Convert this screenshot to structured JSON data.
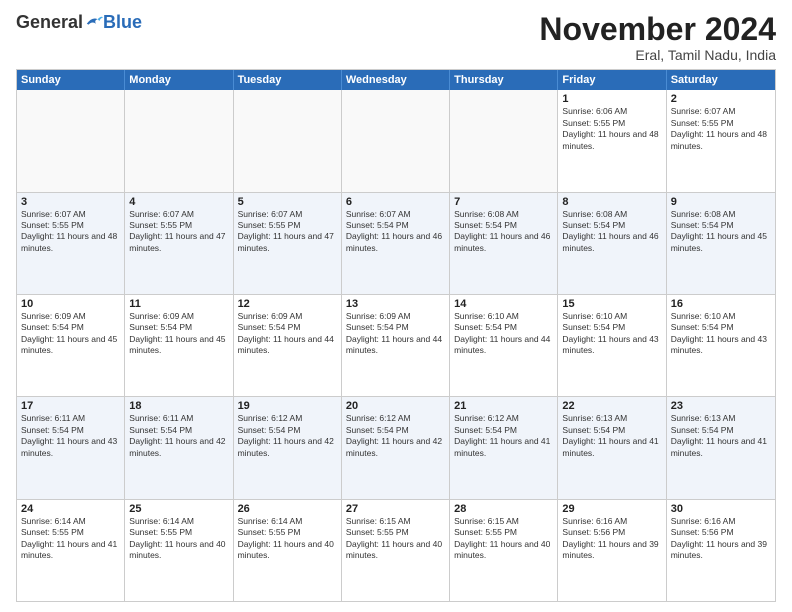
{
  "logo": {
    "general": "General",
    "blue": "Blue"
  },
  "title": "November 2024",
  "location": "Eral, Tamil Nadu, India",
  "header_days": [
    "Sunday",
    "Monday",
    "Tuesday",
    "Wednesday",
    "Thursday",
    "Friday",
    "Saturday"
  ],
  "weeks": [
    [
      {
        "day": "",
        "text": "",
        "empty": true
      },
      {
        "day": "",
        "text": "",
        "empty": true
      },
      {
        "day": "",
        "text": "",
        "empty": true
      },
      {
        "day": "",
        "text": "",
        "empty": true
      },
      {
        "day": "",
        "text": "",
        "empty": true
      },
      {
        "day": "1",
        "text": "Sunrise: 6:06 AM\nSunset: 5:55 PM\nDaylight: 11 hours and 48 minutes.",
        "empty": false
      },
      {
        "day": "2",
        "text": "Sunrise: 6:07 AM\nSunset: 5:55 PM\nDaylight: 11 hours and 48 minutes.",
        "empty": false
      }
    ],
    [
      {
        "day": "3",
        "text": "Sunrise: 6:07 AM\nSunset: 5:55 PM\nDaylight: 11 hours and 48 minutes.",
        "empty": false
      },
      {
        "day": "4",
        "text": "Sunrise: 6:07 AM\nSunset: 5:55 PM\nDaylight: 11 hours and 47 minutes.",
        "empty": false
      },
      {
        "day": "5",
        "text": "Sunrise: 6:07 AM\nSunset: 5:55 PM\nDaylight: 11 hours and 47 minutes.",
        "empty": false
      },
      {
        "day": "6",
        "text": "Sunrise: 6:07 AM\nSunset: 5:54 PM\nDaylight: 11 hours and 46 minutes.",
        "empty": false
      },
      {
        "day": "7",
        "text": "Sunrise: 6:08 AM\nSunset: 5:54 PM\nDaylight: 11 hours and 46 minutes.",
        "empty": false
      },
      {
        "day": "8",
        "text": "Sunrise: 6:08 AM\nSunset: 5:54 PM\nDaylight: 11 hours and 46 minutes.",
        "empty": false
      },
      {
        "day": "9",
        "text": "Sunrise: 6:08 AM\nSunset: 5:54 PM\nDaylight: 11 hours and 45 minutes.",
        "empty": false
      }
    ],
    [
      {
        "day": "10",
        "text": "Sunrise: 6:09 AM\nSunset: 5:54 PM\nDaylight: 11 hours and 45 minutes.",
        "empty": false
      },
      {
        "day": "11",
        "text": "Sunrise: 6:09 AM\nSunset: 5:54 PM\nDaylight: 11 hours and 45 minutes.",
        "empty": false
      },
      {
        "day": "12",
        "text": "Sunrise: 6:09 AM\nSunset: 5:54 PM\nDaylight: 11 hours and 44 minutes.",
        "empty": false
      },
      {
        "day": "13",
        "text": "Sunrise: 6:09 AM\nSunset: 5:54 PM\nDaylight: 11 hours and 44 minutes.",
        "empty": false
      },
      {
        "day": "14",
        "text": "Sunrise: 6:10 AM\nSunset: 5:54 PM\nDaylight: 11 hours and 44 minutes.",
        "empty": false
      },
      {
        "day": "15",
        "text": "Sunrise: 6:10 AM\nSunset: 5:54 PM\nDaylight: 11 hours and 43 minutes.",
        "empty": false
      },
      {
        "day": "16",
        "text": "Sunrise: 6:10 AM\nSunset: 5:54 PM\nDaylight: 11 hours and 43 minutes.",
        "empty": false
      }
    ],
    [
      {
        "day": "17",
        "text": "Sunrise: 6:11 AM\nSunset: 5:54 PM\nDaylight: 11 hours and 43 minutes.",
        "empty": false
      },
      {
        "day": "18",
        "text": "Sunrise: 6:11 AM\nSunset: 5:54 PM\nDaylight: 11 hours and 42 minutes.",
        "empty": false
      },
      {
        "day": "19",
        "text": "Sunrise: 6:12 AM\nSunset: 5:54 PM\nDaylight: 11 hours and 42 minutes.",
        "empty": false
      },
      {
        "day": "20",
        "text": "Sunrise: 6:12 AM\nSunset: 5:54 PM\nDaylight: 11 hours and 42 minutes.",
        "empty": false
      },
      {
        "day": "21",
        "text": "Sunrise: 6:12 AM\nSunset: 5:54 PM\nDaylight: 11 hours and 41 minutes.",
        "empty": false
      },
      {
        "day": "22",
        "text": "Sunrise: 6:13 AM\nSunset: 5:54 PM\nDaylight: 11 hours and 41 minutes.",
        "empty": false
      },
      {
        "day": "23",
        "text": "Sunrise: 6:13 AM\nSunset: 5:54 PM\nDaylight: 11 hours and 41 minutes.",
        "empty": false
      }
    ],
    [
      {
        "day": "24",
        "text": "Sunrise: 6:14 AM\nSunset: 5:55 PM\nDaylight: 11 hours and 41 minutes.",
        "empty": false
      },
      {
        "day": "25",
        "text": "Sunrise: 6:14 AM\nSunset: 5:55 PM\nDaylight: 11 hours and 40 minutes.",
        "empty": false
      },
      {
        "day": "26",
        "text": "Sunrise: 6:14 AM\nSunset: 5:55 PM\nDaylight: 11 hours and 40 minutes.",
        "empty": false
      },
      {
        "day": "27",
        "text": "Sunrise: 6:15 AM\nSunset: 5:55 PM\nDaylight: 11 hours and 40 minutes.",
        "empty": false
      },
      {
        "day": "28",
        "text": "Sunrise: 6:15 AM\nSunset: 5:55 PM\nDaylight: 11 hours and 40 minutes.",
        "empty": false
      },
      {
        "day": "29",
        "text": "Sunrise: 6:16 AM\nSunset: 5:56 PM\nDaylight: 11 hours and 39 minutes.",
        "empty": false
      },
      {
        "day": "30",
        "text": "Sunrise: 6:16 AM\nSunset: 5:56 PM\nDaylight: 11 hours and 39 minutes.",
        "empty": false
      }
    ]
  ]
}
